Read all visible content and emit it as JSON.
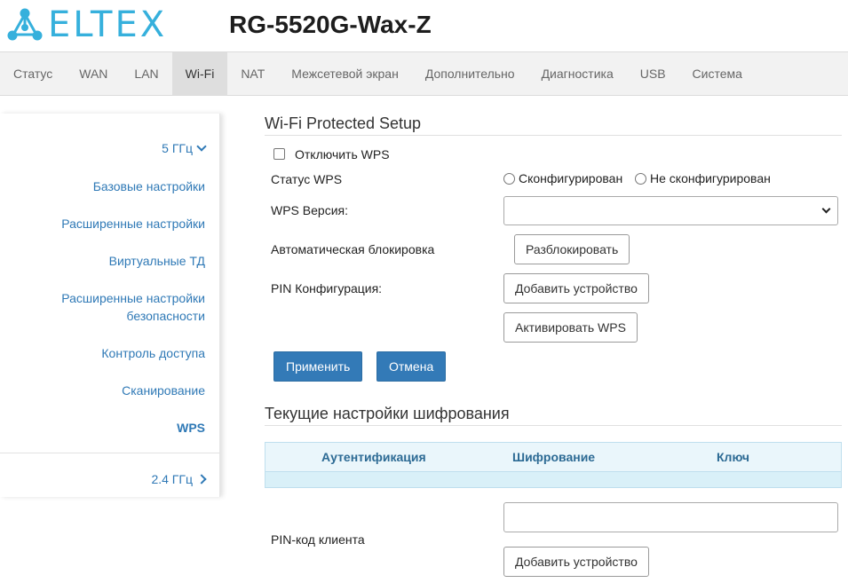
{
  "header": {
    "logo_text": "ELTEX",
    "device_title": "RG-5520G-Wax-Z"
  },
  "nav": {
    "items": [
      "Статус",
      "WAN",
      "LAN",
      "Wi-Fi",
      "NAT",
      "Межсетевой экран",
      "Дополнительно",
      "Диагностика",
      "USB",
      "Система"
    ],
    "active": "Wi-Fi"
  },
  "sidebar": {
    "group_5ghz": "5 ГГц",
    "items": [
      "Базовые настройки",
      "Расширенные настройки",
      "Виртуальные ТД",
      "Расширенные настройки безопасности",
      "Контроль доступа",
      "Сканирование",
      "WPS"
    ],
    "active": "WPS",
    "group_24ghz": "2.4 ГГц"
  },
  "wps": {
    "section_title": "Wi-Fi Protected Setup",
    "disable_label": "Отключить WPS",
    "disable_checked": false,
    "status_label": "Статус WPS",
    "status_option_configured": "Сконфигурирован",
    "status_option_not_configured": "Не сконфигурирован",
    "version_label": "WPS Версия:",
    "version_value": "",
    "auto_lock_label": "Автоматическая блокировка",
    "unlock_button": "Разблокировать",
    "pin_config_label": "PIN Конфигурация:",
    "add_device_button": "Добавить устройство",
    "activate_button": "Активировать WPS",
    "apply_button": "Применить",
    "cancel_button": "Отмена"
  },
  "encryption": {
    "section_title": "Текущие настройки шифрования",
    "columns": [
      "Аутентификация",
      "Шифрование",
      "Ключ"
    ],
    "rows": []
  },
  "client_pin": {
    "label": "PIN-код клиента",
    "value": "",
    "add_device_button": "Добавить устройство"
  },
  "colors": {
    "brand": "#36b0dc",
    "link": "#2f79b6",
    "primary_button": "#337ab7",
    "table_header_bg": "#eaf6fb"
  }
}
